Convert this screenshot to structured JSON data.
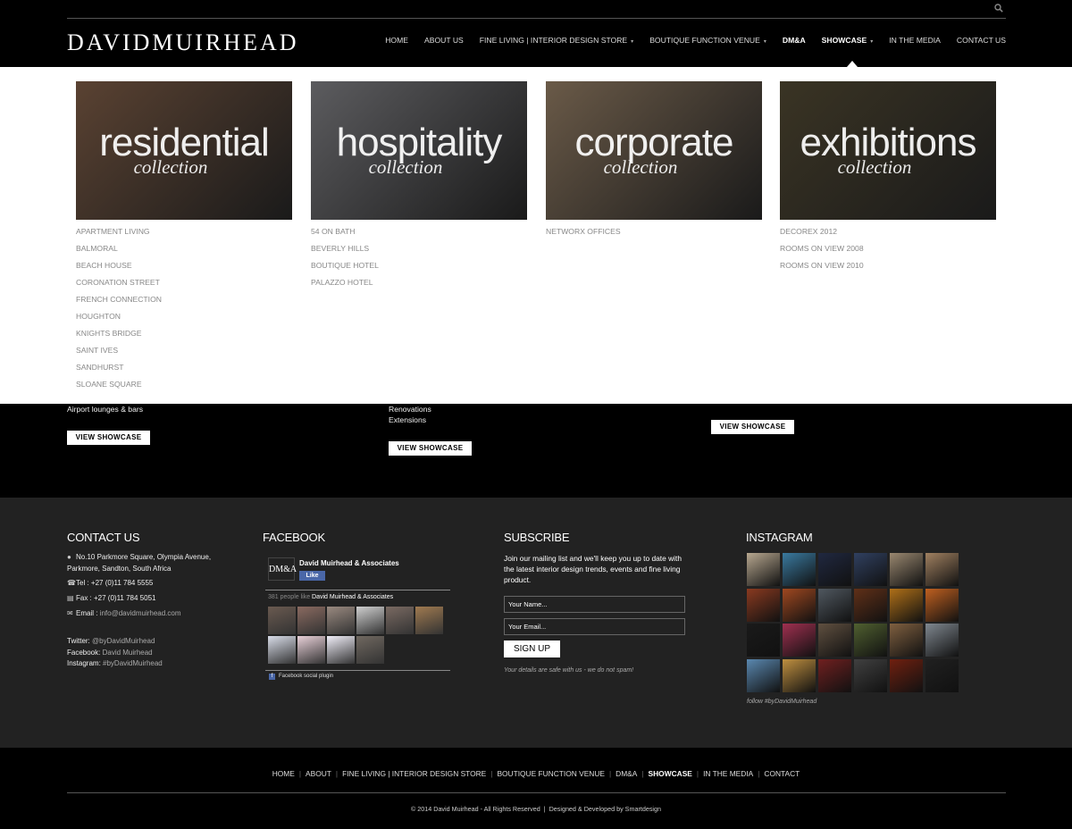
{
  "header": {
    "logo": "DAVIDMUIRHEAD",
    "nav": [
      {
        "label": "HOME"
      },
      {
        "label": "ABOUT US"
      },
      {
        "label": "FINE LIVING | INTERIOR DESIGN STORE",
        "dropdown": true
      },
      {
        "label": "BOUTIQUE FUNCTION VENUE",
        "dropdown": true
      },
      {
        "label": "DM&A",
        "bold": true
      },
      {
        "label": "SHOWCASE",
        "dropdown": true,
        "bold": true,
        "active": true
      },
      {
        "label": "IN THE MEDIA"
      },
      {
        "label": "CONTACT US"
      }
    ]
  },
  "mega": {
    "columns": [
      {
        "word": "residential",
        "sub": "collection",
        "bg": "#5a4232",
        "links": [
          "APARTMENT LIVING",
          "BALMORAL",
          "BEACH HOUSE",
          "CORONATION STREET",
          "FRENCH CONNECTION",
          "HOUGHTON",
          "KNIGHTS BRIDGE",
          "SAINT IVES",
          "SANDHURST",
          "SLOANE SQUARE"
        ]
      },
      {
        "word": "hospitality",
        "sub": "collection",
        "bg": "#5c5c5f",
        "links": [
          "54 ON BATH",
          "BEVERLY HILLS",
          "BOUTIQUE HOTEL",
          "PALAZZO HOTEL"
        ]
      },
      {
        "word": "corporate",
        "sub": "collection",
        "bg": "#6a5a48",
        "links": [
          "NETWORX OFFICES"
        ]
      },
      {
        "word": "exhibitions",
        "sub": "collection",
        "bg": "#3a3424",
        "links": [
          "DECOREX 2012",
          "ROOMS ON VIEW 2008",
          "ROOMS ON VIEW 2010"
        ]
      }
    ]
  },
  "band": {
    "col1_text": "Airport lounges & bars",
    "col2_text1": "Renovations",
    "col2_text2": "Extensions",
    "view_showcase": "VIEW SHOWCASE"
  },
  "footer": {
    "contact": {
      "heading": "CONTACT US",
      "address1": "No.10 Parkmore Square, Olympia Avenue,",
      "address2": "Parkmore, Sandton, South Africa",
      "tel": "Tel : +27 (0)11 784 5555",
      "fax": "Fax : +27 (0)11 784 5051",
      "email_label": "Email :",
      "email": "info@davidmuirhead.com",
      "twitter_label": "Twitter:",
      "twitter": "@byDavidMuirhead",
      "facebook_label": "Facebook:",
      "facebook": "David Muirhead",
      "instagram_label": "Instagram:",
      "instagram": "#byDavidMuirhead"
    },
    "facebook": {
      "heading": "FACEBOOK",
      "logo": "DM&A",
      "page_name": "David Muirhead & Associates",
      "like": "Like",
      "count_text": "381 people like",
      "count_page": "David Muirhead & Associates",
      "plugin": "Facebook social plugin"
    },
    "subscribe": {
      "heading": "SUBSCRIBE",
      "text": "Join our mailing list and we'll keep you up to date with the latest interior design trends, events and fine living product.",
      "name_placeholder": "Your Name...",
      "email_placeholder": "Your Email...",
      "button": "SIGN UP",
      "note": "Your details are safe with us - we do not spam!"
    },
    "instagram": {
      "heading": "INSTAGRAM",
      "follow": "follow #byDavidMuirhead"
    }
  },
  "bottom": {
    "nav": [
      "HOME",
      "ABOUT",
      "FINE LIVING | INTERIOR DESIGN STORE",
      "BOUTIQUE FUNCTION VENUE",
      "DM&A",
      "SHOWCASE",
      "IN THE MEDIA",
      "CONTACT"
    ],
    "active": "SHOWCASE",
    "copyright": "© 2014 David Muirhead - All Rights Reserved",
    "designed": "Designed & Developed by Smartdesign"
  }
}
